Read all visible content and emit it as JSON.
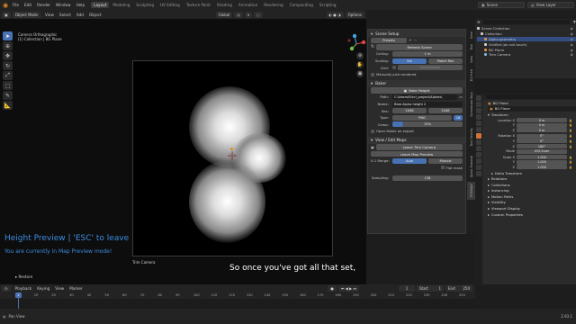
{
  "topbar": {
    "menus": [
      "File",
      "Edit",
      "Render",
      "Window",
      "Help"
    ],
    "workspaces": [
      "Layout",
      "Modeling",
      "Sculpting",
      "UV Editing",
      "Texture Paint",
      "Shading",
      "Animation",
      "Rendering",
      "Compositing",
      "Scripting"
    ],
    "active_workspace": "Layout",
    "scene": "Scene",
    "view_layer": "View Layer"
  },
  "viewport_header": {
    "mode": "Object Mode",
    "menus": [
      "View",
      "Select",
      "Add",
      "Object"
    ],
    "transform": "Global",
    "options": "Options"
  },
  "camera_info": {
    "line1": "Camera Orthographic",
    "line2": "(1) Collection | BG Plane"
  },
  "overlay": {
    "title": "Height Preview | 'ESC' to leave",
    "subtitle": "You are currently in Map Preview mode!",
    "caption": "So once you've got all that set,",
    "camera_label": "Trim Camera",
    "redo_panel": "Restore"
  },
  "npanel": {
    "scene_setup": {
      "header": "Scene Setup",
      "preset_label": "Presets",
      "refresh_scene": "Refresh Scene",
      "ceiling_label": "Ceiling:",
      "ceiling_value": "1 m",
      "scaling_label": "Scaling:",
      "scaling_options": [
        "Set",
        "Match Res"
      ],
      "grid_label": "Grid:",
      "grid_value": "Subdivisions",
      "manual_pick": "Manually pick rendered"
    },
    "baker": {
      "header": "Baker",
      "bake_button": "Bake Height",
      "path_label": "Path:",
      "path_value": "C:\\Users\\Ricci_project\\Alphas\\",
      "name_label": "Name:",
      "name_value": "Blob Alpha height 2",
      "res_label": "Res:",
      "res_x": "2048",
      "res_y": "2048",
      "type_label": "Type:",
      "type_value": "PNG",
      "type_bits": "16",
      "comp_label": "Comp:",
      "comp_value": "15%",
      "open_folder": "Open folder on export"
    },
    "view_edit_maps": {
      "header": "View / Edit Maps",
      "leave_trim": "Leave Trim Camera",
      "leave_preview": "Leave Map Preview",
      "range_label": "0-1 Range:",
      "range_options": [
        "Auto",
        "Manual"
      ],
      "flat_mask": "Flat mask",
      "sampling_label": "Sampling:",
      "sampling_value": "128"
    },
    "tabs": [
      "Item",
      "Tool",
      "View",
      "3D-Print",
      "Screencast Keys",
      "Tool Density",
      "Quick Remesh",
      "TRIMMAP"
    ]
  },
  "outliner": {
    "items": [
      {
        "name": "Scene Collection",
        "color": "#cfcfcf",
        "selected": false
      },
      {
        "name": "Collection",
        "color": "#cfcfcf",
        "selected": false
      },
      {
        "name": "Alpha geometry",
        "color": "#e0913a",
        "selected": true
      },
      {
        "name": "GridSet (do not touch)",
        "color": "#cfcfcf",
        "selected": false
      },
      {
        "name": "BG Plane",
        "color": "#e0913a",
        "selected": false
      },
      {
        "name": "Trim Camera",
        "color": "#7fb2e6",
        "selected": false
      }
    ]
  },
  "properties": {
    "object_name": "BG Plane",
    "object_title": "BG Plane",
    "transform_header": "Transform",
    "location_label": "Location X",
    "location": [
      "0 m",
      "0 m",
      "0 m"
    ],
    "rotation_label": "Rotation X",
    "rotation": [
      "0°",
      "0°",
      "180°"
    ],
    "mode_label": "Mode",
    "mode_value": "XYZ Euler",
    "scale_label": "Scale X",
    "scale": [
      "1.000",
      "1.000",
      "1.000"
    ],
    "delta_transform": "Delta Transform",
    "sections": [
      "Relations",
      "Collections",
      "Instancing",
      "Motion Paths",
      "Visibility",
      "Viewport Display",
      "Custom Properties"
    ]
  },
  "timeline": {
    "menus": [
      "Playback",
      "Keying",
      "View",
      "Marker"
    ],
    "start_label": "Start",
    "start_value": "1",
    "end_label": "End",
    "end_value": "250",
    "current_frame": "1",
    "ticks": [
      "1",
      "10",
      "20",
      "30",
      "40",
      "50",
      "60",
      "70",
      "80",
      "90",
      "100",
      "110",
      "120",
      "130",
      "140",
      "150",
      "160",
      "170",
      "180",
      "190",
      "200",
      "210",
      "220",
      "230",
      "240",
      "250"
    ]
  },
  "statusbar": {
    "left": "Pan View",
    "version": "2.93.1"
  }
}
